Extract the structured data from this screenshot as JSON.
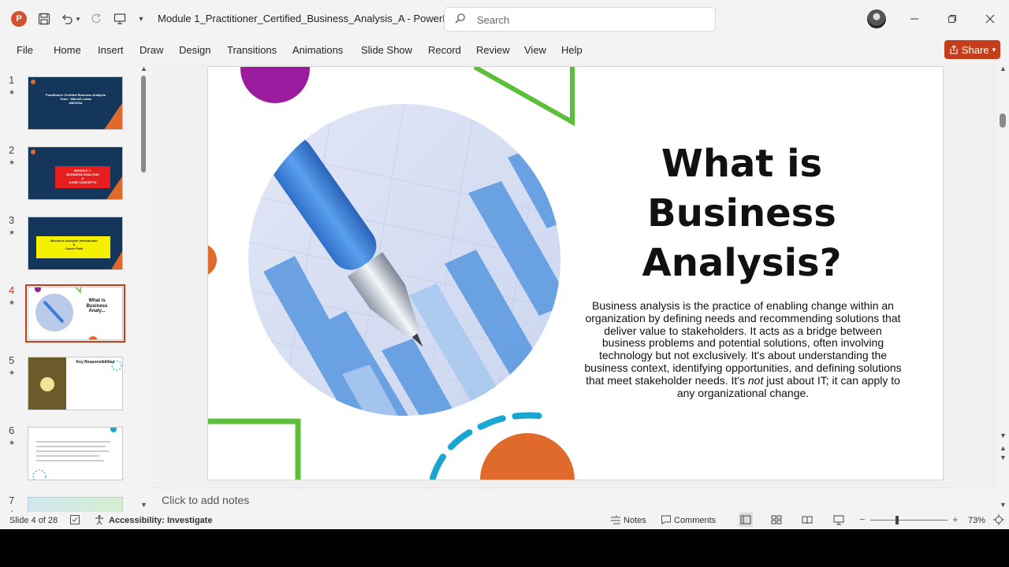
{
  "window": {
    "app_logo": "P",
    "doc_title": "Module 1_Practitioner_Certified_Business_Analysis_A  -  PowerP...",
    "search_placeholder": "Search",
    "icons": [
      "save-icon",
      "undo-icon",
      "redo-icon",
      "present-icon",
      "more-icon"
    ]
  },
  "ribbon": {
    "tabs": [
      "File",
      "Home",
      "Insert",
      "Draw",
      "Design",
      "Transitions",
      "Animations",
      "Slide Show",
      "Record",
      "Review",
      "View",
      "Help"
    ],
    "share_label": "Share"
  },
  "thumbnails": [
    {
      "num": "1",
      "label": "Practitioner Certified Business Analysis\nTutor : Marvell Lukaz\nABCDSA"
    },
    {
      "num": "2",
      "label": "MODULE 1:\nBUSINESS ANALYSIS\n&\nCORE CONCEPTS"
    },
    {
      "num": "3",
      "label": "Business Analysis Introduction\n&\nCareer Path"
    },
    {
      "num": "4",
      "label": "What is\nBusiness\nAnaly..."
    },
    {
      "num": "5",
      "label": "Key Responsibilities"
    },
    {
      "num": "6",
      "label": ""
    },
    {
      "num": "7",
      "label": ""
    }
  ],
  "slide": {
    "title": "What is Business Analysis?",
    "body": "Business analysis is the practice of enabling change within an organization by defining needs and recommending solutions that deliver value to stakeholders. It acts as a bridge between business problems and potential solutions, often involving technology but not exclusively. It's about understanding the business context, identifying opportunities, and defining solutions that meet stakeholder needs. It's not just about IT; it can apply to any organizational change.",
    "body_emphasis": "not",
    "colors": {
      "purple": "#9b1c9e",
      "green": "#5cbf3a",
      "orange": "#e06a2c",
      "cyan": "#19a6d1"
    }
  },
  "notes": {
    "placeholder": "Click to add notes"
  },
  "status": {
    "slide_counter": "Slide 4 of 28",
    "accessibility": "Accessibility: Investigate",
    "notes_label": "Notes",
    "comments_label": "Comments",
    "zoom": "73%"
  }
}
